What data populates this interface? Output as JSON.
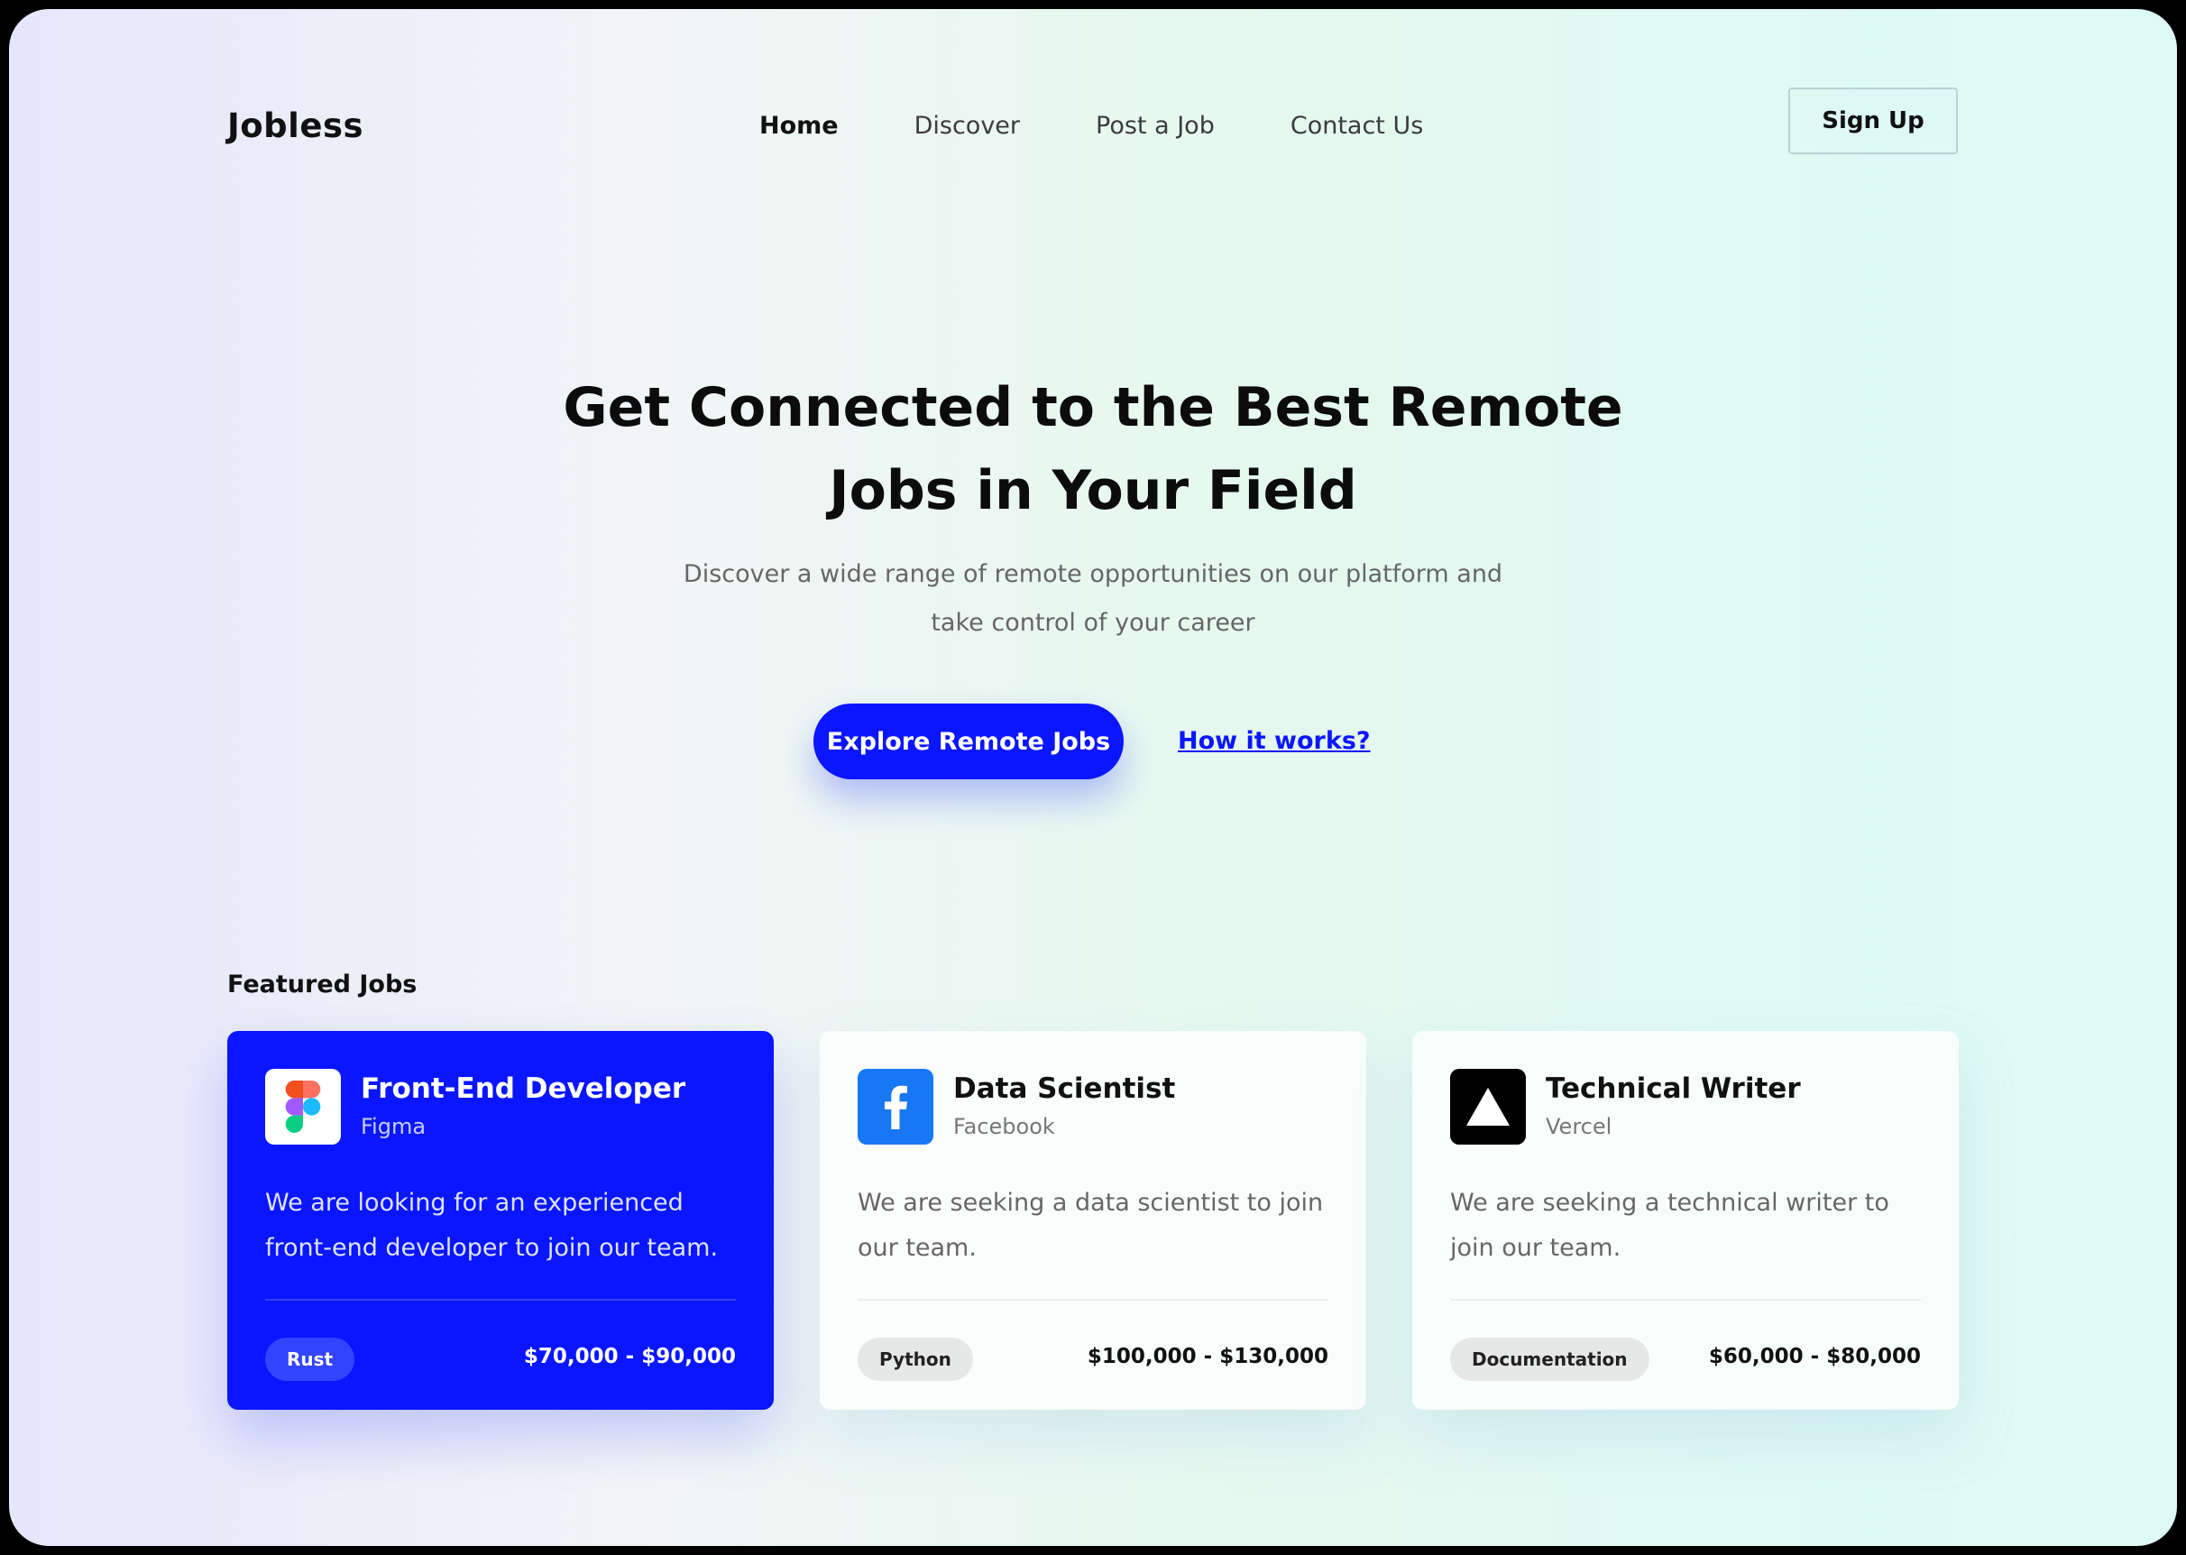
{
  "header": {
    "logo": "Jobless",
    "nav": [
      "Home",
      "Discover",
      "Post a Job",
      "Contact Us"
    ],
    "active_nav": "Home",
    "signup_label": "Sign Up"
  },
  "hero": {
    "title": "Get Connected to the Best Remote Jobs in Your Field",
    "subtitle": "Discover a wide range of remote opportunities on our platform and take control of your career",
    "primary_cta": "Explore Remote Jobs",
    "secondary_cta": "How it works?"
  },
  "featured": {
    "heading": "Featured Jobs",
    "jobs": [
      {
        "title": "Front-End Developer",
        "company": "Figma",
        "logo_icon": "figma-logo-icon",
        "description": "We are looking for an experienced front-end developer to join our team.",
        "tag": "Rust",
        "salary": "$70,000 - $90,000",
        "highlighted": true
      },
      {
        "title": "Data Scientist",
        "company": "Facebook",
        "logo_icon": "facebook-logo-icon",
        "description": "We are seeking a data scientist to join our team.",
        "tag": "Python",
        "salary": "$100,000 - $130,000",
        "highlighted": false
      },
      {
        "title": "Technical Writer",
        "company": "Vercel",
        "logo_icon": "vercel-logo-icon",
        "description": "We are seeking a technical writer to join our team.",
        "tag": "Documentation",
        "salary": "$60,000 - $80,000",
        "highlighted": false
      }
    ]
  },
  "colors": {
    "accent": "#0a16ff",
    "facebook_blue": "#1877f2",
    "tag_background": "#e6e8e8"
  }
}
